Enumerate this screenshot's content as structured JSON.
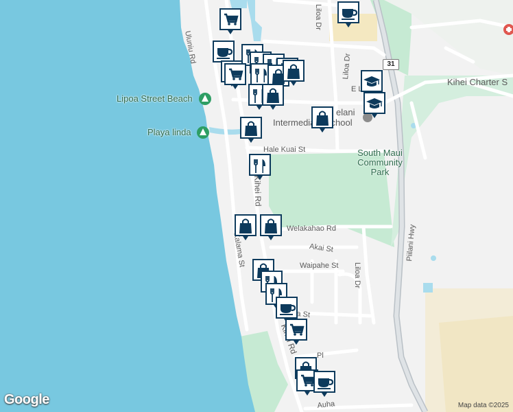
{
  "map": {
    "streets": [
      {
        "id": "uluniu-rd",
        "name": "Uluniu Rd"
      },
      {
        "id": "liloa-dr-top",
        "name": "Liloa Dr"
      },
      {
        "id": "liloa-dr-mid",
        "name": "Liloa Dr"
      },
      {
        "id": "liloa-dr-low",
        "name": "Liloa Dr"
      },
      {
        "id": "e-lipoa",
        "name": "E L"
      },
      {
        "id": "hale-kuai-st",
        "name": "Hale Kuai St"
      },
      {
        "id": "kihei-rd",
        "name": "Kihei Rd"
      },
      {
        "id": "kihei-rd-lower",
        "name": "Kihei Rd"
      },
      {
        "id": "welakahao-rd",
        "name": "Welakahao Rd"
      },
      {
        "id": "akai-st",
        "name": "Akai St"
      },
      {
        "id": "waipahe-st",
        "name": "Waipahe St"
      },
      {
        "id": "kaiama-st",
        "name": "Kalama St"
      },
      {
        "id": "ma-st",
        "name": "ma St"
      },
      {
        "id": "pl",
        "name": "Pl"
      },
      {
        "id": "piilani-hwy",
        "name": "Piilani Hwy"
      },
      {
        "id": "auh",
        "name": "Auha"
      }
    ],
    "places": [
      {
        "id": "lipoa-street-beach",
        "name": "Lipoa Street Beach"
      },
      {
        "id": "playa-linda",
        "name": "Playa linda"
      },
      {
        "id": "kihei-charter",
        "name": "Kihei Charter S"
      },
      {
        "id": "south-maui-park",
        "name": "South Maui Community Park"
      },
      {
        "id": "lokelani-school",
        "name": "Intermediate School"
      },
      {
        "id": "elani",
        "name": "elani"
      }
    ],
    "highway_shield": "31",
    "pins": [
      {
        "type": "shopping-cart"
      },
      {
        "type": "coffee"
      },
      {
        "type": "coffee"
      },
      {
        "type": "shopping-cart"
      },
      {
        "type": "restaurant"
      },
      {
        "type": "restaurant"
      },
      {
        "type": "restaurant"
      },
      {
        "type": "restaurant"
      },
      {
        "type": "shopping-cart"
      },
      {
        "type": "restaurant"
      },
      {
        "type": "shopping-bag"
      },
      {
        "type": "shopping-bag"
      },
      {
        "type": "restaurant"
      },
      {
        "type": "shopping-bag"
      },
      {
        "type": "school"
      },
      {
        "type": "school"
      },
      {
        "type": "shopping-bag"
      },
      {
        "type": "shopping-bag"
      },
      {
        "type": "restaurant"
      },
      {
        "type": "shopping-bag"
      },
      {
        "type": "shopping-bag"
      },
      {
        "type": "shopping-bag"
      },
      {
        "type": "restaurant"
      },
      {
        "type": "restaurant"
      },
      {
        "type": "coffee"
      },
      {
        "type": "shopping-cart"
      },
      {
        "type": "shopping-bag"
      },
      {
        "type": "shopping-cart"
      },
      {
        "type": "coffee"
      }
    ],
    "google_logo": "Google",
    "attribution": "Map data ©2025",
    "colors": {
      "water": "#78c8e0",
      "land": "#f2f2f2",
      "park": "#c6ead3",
      "sand": "#f4e8c1",
      "pin": "#0d3a5c",
      "pin_bg": "#ffffff",
      "road": "#ffffff",
      "highway": "#c9ced3"
    }
  }
}
